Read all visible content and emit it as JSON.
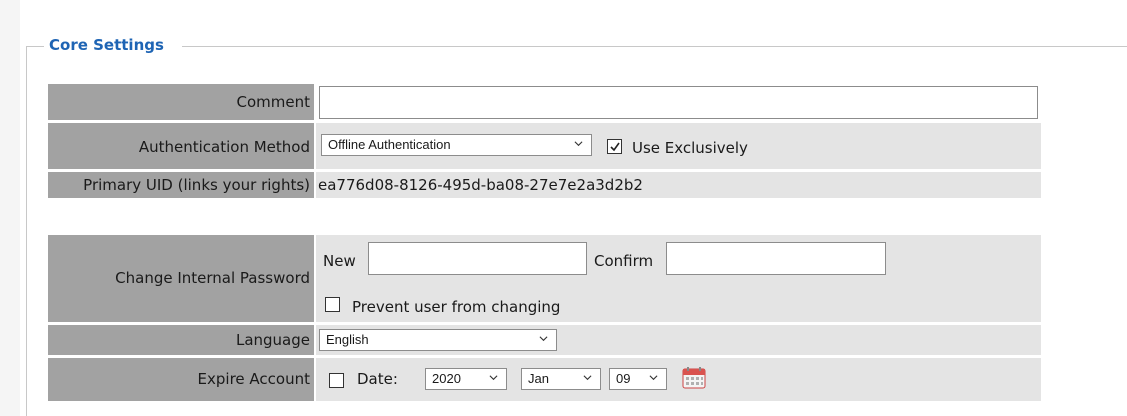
{
  "section": {
    "legend": "Core Settings"
  },
  "comment": {
    "label": "Comment",
    "value": ""
  },
  "auth": {
    "label": "Authentication Method",
    "selected": "Offline Authentication",
    "exclusive_label": "Use Exclusively",
    "exclusive_checked": true
  },
  "uid": {
    "label": "Primary UID (links your rights)",
    "value": "ea776d08-8126-495d-ba08-27e7e2a3d2b2"
  },
  "password": {
    "label": "Change Internal Password",
    "new_label": "New",
    "new_value": "",
    "confirm_label": "Confirm",
    "confirm_value": "",
    "prevent_label": "Prevent user from changing",
    "prevent_checked": false
  },
  "language": {
    "label": "Language",
    "selected": "English"
  },
  "expire": {
    "label": "Expire Account",
    "checked": false,
    "date_label": "Date:",
    "year": "2020",
    "month": "Jan",
    "day": "09",
    "calendar_icon": "calendar-icon"
  },
  "colors": {
    "legend": "#1e64b4",
    "label_bg": "#a2a2a2",
    "value_bg": "#e4e4e4"
  }
}
